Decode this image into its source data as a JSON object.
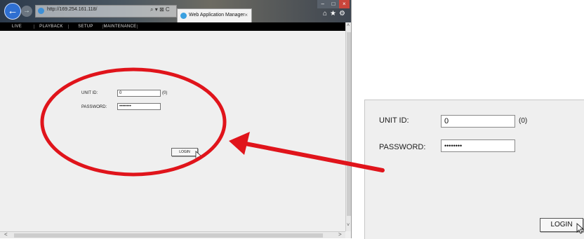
{
  "browser": {
    "address": "http://169.254.161.118/",
    "address_controls": "⌕ ▾ ⊠ C",
    "tab_title": "Web Application Manager",
    "tab_close": "×",
    "back_glyph": "←",
    "forward_glyph": "→",
    "toolbar_glyphs": "⌂★⚙",
    "window_controls": {
      "minimize": "–",
      "maximize": "□",
      "close": "×"
    },
    "scroll_up": "˄",
    "scroll_down": "˅",
    "scroll_left": "<",
    "scroll_right": ">"
  },
  "menu": {
    "items": [
      "LIVE",
      "PLAYBACK",
      "SETUP",
      "MAINTENANCE"
    ]
  },
  "login_form": {
    "unit_id_label": "UNIT ID:",
    "unit_id_value": "0",
    "unit_id_hint": "(0)",
    "password_label": "PASSWORD:",
    "password_value": "••••••••",
    "login_button": "LOGIN"
  },
  "zoom": {
    "unit_id_label": "UNIT ID:",
    "unit_id_value": "0",
    "unit_id_hint": "(0)",
    "password_label": "PASSWORD:",
    "password_value": "••••••••",
    "login_button": "LOGIN"
  },
  "colors": {
    "annotation": "#e0141b",
    "page_background": "#efefef",
    "menu_bar": "#000000"
  }
}
